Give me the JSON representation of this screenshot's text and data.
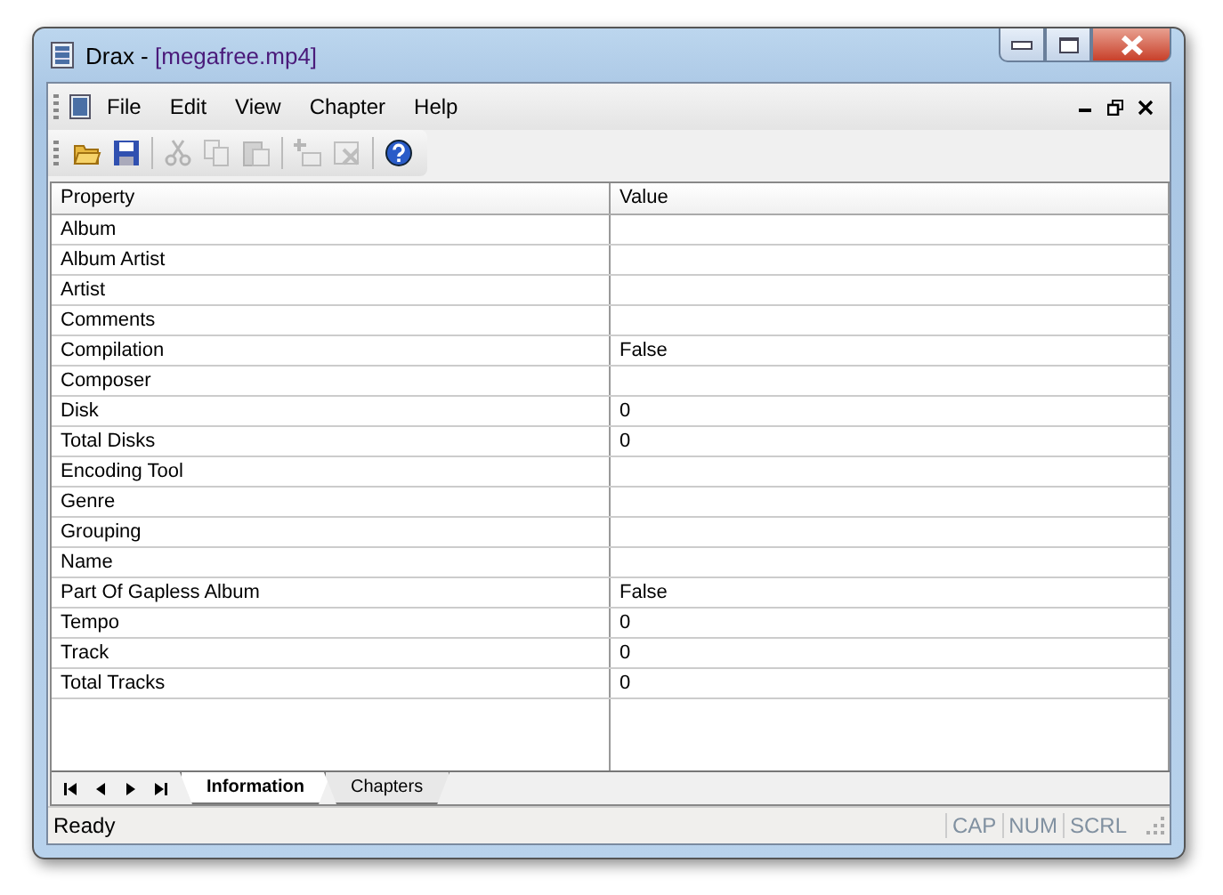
{
  "window": {
    "title_app": "Drax - ",
    "title_doc": "[megafree.mp4]"
  },
  "menu": [
    "File",
    "Edit",
    "View",
    "Chapter",
    "Help"
  ],
  "toolbar": [
    {
      "kind": "open",
      "disabled": false
    },
    {
      "kind": "save",
      "disabled": false
    },
    {
      "kind": "sep"
    },
    {
      "kind": "cut",
      "disabled": true
    },
    {
      "kind": "copy",
      "disabled": true
    },
    {
      "kind": "paste",
      "disabled": true
    },
    {
      "kind": "sep"
    },
    {
      "kind": "add",
      "disabled": true
    },
    {
      "kind": "remove",
      "disabled": true
    },
    {
      "kind": "sep"
    },
    {
      "kind": "help",
      "disabled": false
    }
  ],
  "table": {
    "columns": [
      "Property",
      "Value"
    ],
    "rows": [
      [
        "Album",
        ""
      ],
      [
        "Album Artist",
        ""
      ],
      [
        "Artist",
        ""
      ],
      [
        "Comments",
        ""
      ],
      [
        "Compilation",
        "False"
      ],
      [
        "Composer",
        ""
      ],
      [
        "Disk",
        "0"
      ],
      [
        "Total Disks",
        "0"
      ],
      [
        "Encoding Tool",
        ""
      ],
      [
        "Genre",
        ""
      ],
      [
        "Grouping",
        ""
      ],
      [
        "Name",
        ""
      ],
      [
        "Part Of Gapless Album",
        "False"
      ],
      [
        "Tempo",
        "0"
      ],
      [
        "Track",
        "0"
      ],
      [
        "Total Tracks",
        "0"
      ]
    ]
  },
  "sheet_tabs": [
    {
      "label": "Information",
      "selected": true
    },
    {
      "label": "Chapters",
      "selected": false
    }
  ],
  "status_bar": {
    "text": "Ready",
    "indicators": [
      {
        "label": "CAP",
        "on": false
      },
      {
        "label": "NUM",
        "on": false
      },
      {
        "label": "SCRL",
        "on": false
      }
    ]
  }
}
